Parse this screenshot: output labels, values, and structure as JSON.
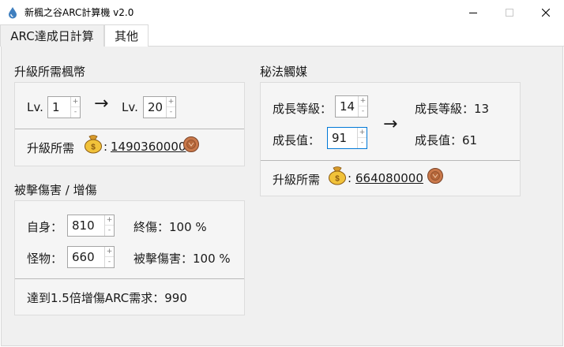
{
  "window": {
    "title": "新楓之谷ARC計算機  v2.0",
    "app_icon": "drop-icon",
    "controls": {
      "minimize_icon": "minimize-icon",
      "maximize_icon": "maximize-icon",
      "close_icon": "close-icon"
    }
  },
  "tabs": [
    {
      "label": "ARC達成日計算",
      "selected": false
    },
    {
      "label": "其他",
      "selected": true
    }
  ],
  "upgrade_cost": {
    "title": "升級所需楓幣",
    "lv_label": "Lv.",
    "lv_from": "1",
    "arrow": "→",
    "lv_to": "20",
    "cost_label": "升級所需",
    "colon": ":",
    "cost_value": "1490360000",
    "bag_icon": "money-bag-icon",
    "coin_icon": "coin-icon"
  },
  "damage": {
    "title": "被擊傷害 / 增傷",
    "self_label": "自身：",
    "self_value": "810",
    "monster_label": "怪物：",
    "monster_value": "660",
    "final_damage": "終傷：100 %",
    "taken_damage": "被擊傷害：100 %",
    "arc_requirement": "達到1.5倍增傷ARC需求：990"
  },
  "catalyst": {
    "title": "秘法觸媒",
    "level_label": "成長等級：",
    "level_value": "14",
    "growth_label": "成長值：",
    "growth_value": "91",
    "arrow": "→",
    "result_level": "成長等級：13",
    "result_growth": "成長值：61",
    "cost_label": "升級所需",
    "colon": ":",
    "cost_value": "664080000",
    "bag_icon": "money-bag-icon",
    "coin_icon": "coin-icon"
  },
  "colors": {
    "accent": "#0078d7",
    "panel_bg": "#f5f5f5",
    "window_bg": "#f0f0f0"
  }
}
